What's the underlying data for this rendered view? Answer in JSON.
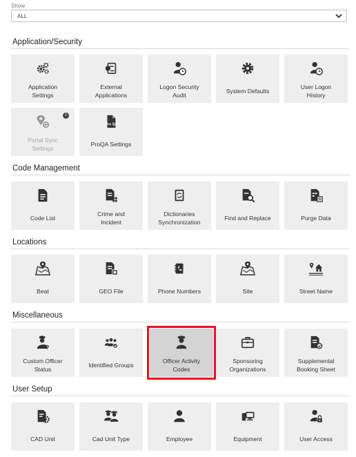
{
  "filter": {
    "label": "Show",
    "value": "ALL"
  },
  "sections": {
    "application_security": {
      "title": "Application/Security",
      "tiles": [
        {
          "label": "Application\nSettings",
          "icon": "gears-icon"
        },
        {
          "label": "External\nApplications",
          "icon": "external-app-icon"
        },
        {
          "label": "Logon Security\nAudit",
          "icon": "user-clock-icon"
        },
        {
          "label": "System Defaults",
          "icon": "gear-icon"
        },
        {
          "label": "User Logon\nHistory",
          "icon": "user-history-icon"
        },
        {
          "label": "Portal Sync\nSettings",
          "icon": "map-sync-icon",
          "badge": "i"
        },
        {
          "label": "ProQA Settings",
          "icon": "proqa-document-icon",
          "icon_text": "Pro QA"
        }
      ]
    },
    "code_management": {
      "title": "Code Management",
      "tiles": [
        {
          "label": "Code List",
          "icon": "code-list-icon"
        },
        {
          "label": "Crime and\nIncident",
          "icon": "crime-document-icon"
        },
        {
          "label": "Dictionaries\nSynchronization",
          "icon": "dictionary-sync-icon"
        },
        {
          "label": "Find and Replace",
          "icon": "document-search-icon"
        },
        {
          "label": "Purge Data",
          "icon": "purge-data-icon"
        }
      ]
    },
    "locations": {
      "title": "Locations",
      "tiles": [
        {
          "label": "Beat",
          "icon": "map-pin-icon"
        },
        {
          "label": "GEO File",
          "icon": "geo-file-icon"
        },
        {
          "label": "Phone Numbers",
          "icon": "phone-book-icon"
        },
        {
          "label": "Site",
          "icon": "map-site-icon"
        },
        {
          "label": "Street Name",
          "icon": "street-house-icon"
        }
      ]
    },
    "miscellaneous": {
      "title": "Miscellaneous",
      "tiles": [
        {
          "label": "Custom Officer\nStatus",
          "icon": "officer-question-icon"
        },
        {
          "label": "Identified Groups",
          "icon": "group-check-icon"
        },
        {
          "label": "Officer Activity\nCodes",
          "icon": "officer-icon",
          "selected": true
        },
        {
          "label": "Sponsoring\nOrganizations",
          "icon": "briefcase-icon"
        },
        {
          "label": "Supplemental\nBooking Sheet",
          "icon": "booking-sheet-icon"
        }
      ]
    },
    "user_setup": {
      "title": "User Setup",
      "tiles": [
        {
          "label": "CAD Unit",
          "icon": "cad-unit-icon"
        },
        {
          "label": "Cad Unit Type",
          "icon": "officers-group-icon"
        },
        {
          "label": "Employee",
          "icon": "employee-icon"
        },
        {
          "label": "Equipment",
          "icon": "equipment-icon"
        },
        {
          "label": "User Access",
          "icon": "user-lock-icon"
        }
      ]
    }
  }
}
